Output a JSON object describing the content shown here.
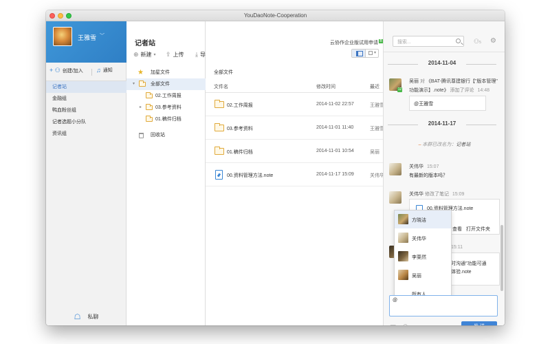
{
  "window": {
    "title": "YouDaoNote-Cooperation"
  },
  "profile": {
    "name": "王雅雪"
  },
  "nav": {
    "create_join": "创建/加入",
    "notify": "通知",
    "groups": [
      "记者站",
      "金融组",
      "鸭血粉丝组",
      "记者选题小分队",
      "资讯组"
    ],
    "private_chat": "私聊"
  },
  "tree": {
    "title": "记者站",
    "new_label": "新建",
    "upload_label": "上传",
    "import_label": "导入笔记",
    "starred": "加星文件",
    "all_files": "全部文件",
    "folders": [
      "02.工作周报",
      "03.参考资料",
      "01.稿件归档"
    ],
    "trash": "回收站"
  },
  "files": {
    "enterprise_link": "云协作企业版试用申请",
    "enterprise_badge": "B",
    "breadcrumb": "全部文件",
    "columns": {
      "name": "文件名",
      "modified": "修改时间",
      "last": "最近"
    },
    "rows": [
      {
        "name": "02.工作周报",
        "date": "",
        "by": "王雅雪"
      },
      {
        "name": "03.参考资料",
        "date": "2014-11-01 11:40",
        "by": "王雅雪"
      },
      {
        "name": "01.稿件归档",
        "date": "2014-11-01 10:54",
        "by": "吴丽"
      },
      {
        "name": "00.资料管理方法.note",
        "date": "2014-11-17 15:09",
        "by": "关伟华"
      }
    ],
    "first_row_date": "2014-11-02 22:57"
  },
  "chat": {
    "search_placeholder": "搜索...",
    "member_count": "5",
    "date1": "2014-11-04",
    "msg1": {
      "user": "吴丽",
      "verb": "对",
      "title_line1": "《BAT-腾讯尊建银行【\"版本管理\"",
      "title_line2": "功能演示】.note》",
      "action": "添加了评论",
      "time": "14:48",
      "badge": "12",
      "comment": "@王雅雪"
    },
    "date2": "2014-11-17",
    "system": {
      "prefix": "本群已改名为：",
      "name": "记者站"
    },
    "msg2": {
      "user": "关伟华",
      "time": "15:07",
      "text": "有最新的版本吗？"
    },
    "msg3": {
      "user": "关伟华",
      "action": "修改了笔记",
      "time": "15:09",
      "file": "00.资料管理方法.note",
      "view": "查看",
      "open_folder": "打开文件夹"
    },
    "msg4": {
      "time": "15:11",
      "line1": "时沟通\"功能可通",
      "line2": "体验.note"
    },
    "mention_list": [
      "方晓洁",
      "关伟华",
      "李栗然",
      "吴丽",
      "所有人"
    ],
    "compose_text": "@",
    "send_label": "发 送"
  }
}
